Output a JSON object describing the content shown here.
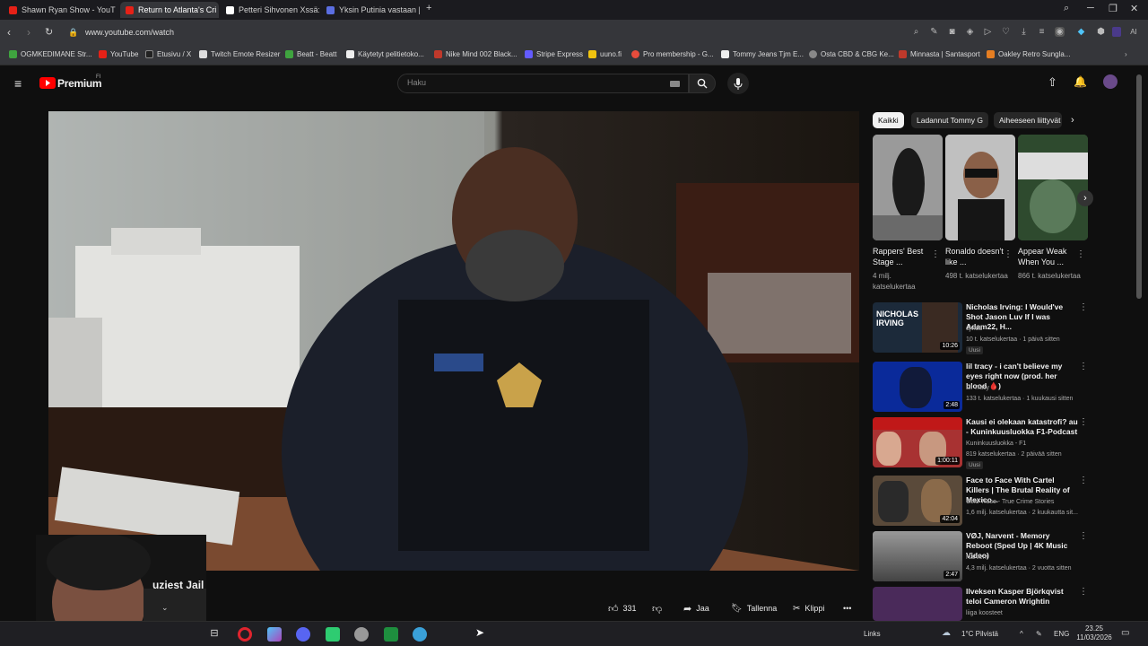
{
  "browser": {
    "tabs": [
      {
        "title": "Shawn Ryan Show - YouT",
        "color": "#e62117"
      },
      {
        "title": "Return to Atlanta's Cri",
        "color": "#e62117",
        "active": true
      },
      {
        "title": "Petteri Sihvonen Xssä: \"N",
        "color": "#ffffff"
      },
      {
        "title": "Yksin Putinia vastaan | Yle",
        "color": "#5b6ee1"
      }
    ],
    "new_tab": "+",
    "url": "www.youtube.com/watch",
    "bookmarks": [
      {
        "label": "OGMKEDIMANE Str...",
        "color": "#3fa43f"
      },
      {
        "label": "YouTube",
        "color": "#e62117"
      },
      {
        "label": "Etusivu / X",
        "color": "#222222"
      },
      {
        "label": "Twitch Emote Resizer",
        "color": "#dddddd"
      },
      {
        "label": "Beatt - Beatt",
        "color": "#3fa43f"
      },
      {
        "label": "Käytetyt pelitietoko...",
        "color": "#eeeeee"
      },
      {
        "label": "Nike Mind 002 Black...",
        "color": "#c0392b"
      },
      {
        "label": "Stripe Express",
        "color": "#635bff"
      },
      {
        "label": "uuno.fi",
        "color": "#f1c40f"
      },
      {
        "label": "Pro membership - G...",
        "color": "#e74c3c"
      },
      {
        "label": "Tommy Jeans Tjm E...",
        "color": "#eeeeee"
      },
      {
        "label": "Osta CBD & CBG Ke...",
        "color": "#888888"
      },
      {
        "label": "Minnasta | Santasport",
        "color": "#c0392b"
      },
      {
        "label": "Oakley Retro Sungla...",
        "color": "#e67e22"
      }
    ]
  },
  "youtube": {
    "logo_text": "Premium",
    "logo_sup": "FI",
    "search_placeholder": "Haku",
    "video_title": "uziest Jail",
    "actions": {
      "likes": "331",
      "share": "Jaa",
      "save": "Tallenna",
      "clip": "Klippi"
    },
    "chips": [
      "Kaikki",
      "Ladannut Tommy G",
      "Aiheeseen liittyvät"
    ],
    "shorts": [
      {
        "title": "Rappers' Best Stage ...",
        "views": "4 milj. katselukertaa",
        "bg": "#8a8a8a"
      },
      {
        "title": "Ronaldo doesn't like ...",
        "views": "498 t. katselukertaa",
        "bg": "#c9c9c9"
      },
      {
        "title": "Appear Weak When You ...",
        "views": "866 t. katselukertaa",
        "bg": "#3c6e3c"
      }
    ],
    "recommended": [
      {
        "title": "Nicholas Irving: I Would've Shot Jason Luv If I was Adam22, H...",
        "channel": "djvlad",
        "meta": "10 t. katselukertaa · 1 päivä sitten",
        "badge": "Uusi",
        "duration": "10:26",
        "bg": "#1c2a3a"
      },
      {
        "title": "lil tracy - i can't believe my eyes right now (prod. her blood 🩸)",
        "channel": "Lil Tracy",
        "meta": "133 t. katselukertaa · 1 kuukausi sitten",
        "badge": "",
        "duration": "2:48",
        "bg": "#0a2a9a"
      },
      {
        "title": "Kausi ei olekaan katastrofi? au - Kuninkuusluokka F1-Podcast",
        "channel": "Kuninkuusluokka - F1",
        "meta": "819 katselukertaa · 2 päivää sitten",
        "badge": "Uusi",
        "duration": "1:00:11",
        "bg": "#a83232"
      },
      {
        "title": "Face to Face With Cartel Killers | The Brutal Reality of Mexico...",
        "channel": "Cold Trace - True Crime Stories",
        "meta": "1,6 milj. katselukertaa · 2 kuukautta sit...",
        "badge": "",
        "duration": "42:04",
        "bg": "#5a4a3a"
      },
      {
        "title": "VØJ, Narvent - Memory Reboot (Sped Up | 4K Music Video)",
        "channel": "Narvent",
        "meta": "4,3 milj. katselukertaa · 2 vuotta sitten",
        "badge": "",
        "duration": "2:47",
        "bg": "#7a7a7a"
      },
      {
        "title": "Ilveksen Kasper Björkqvist teloi Cameron Wrightin",
        "channel": "liiga koosteet",
        "meta": "",
        "badge": "",
        "duration": "",
        "bg": "#4a2a5a"
      }
    ]
  },
  "taskbar": {
    "links": "Links",
    "weather": "1°C Pilvistä",
    "lang": "ENG",
    "time": "23.25",
    "date": "11/03/2026"
  }
}
